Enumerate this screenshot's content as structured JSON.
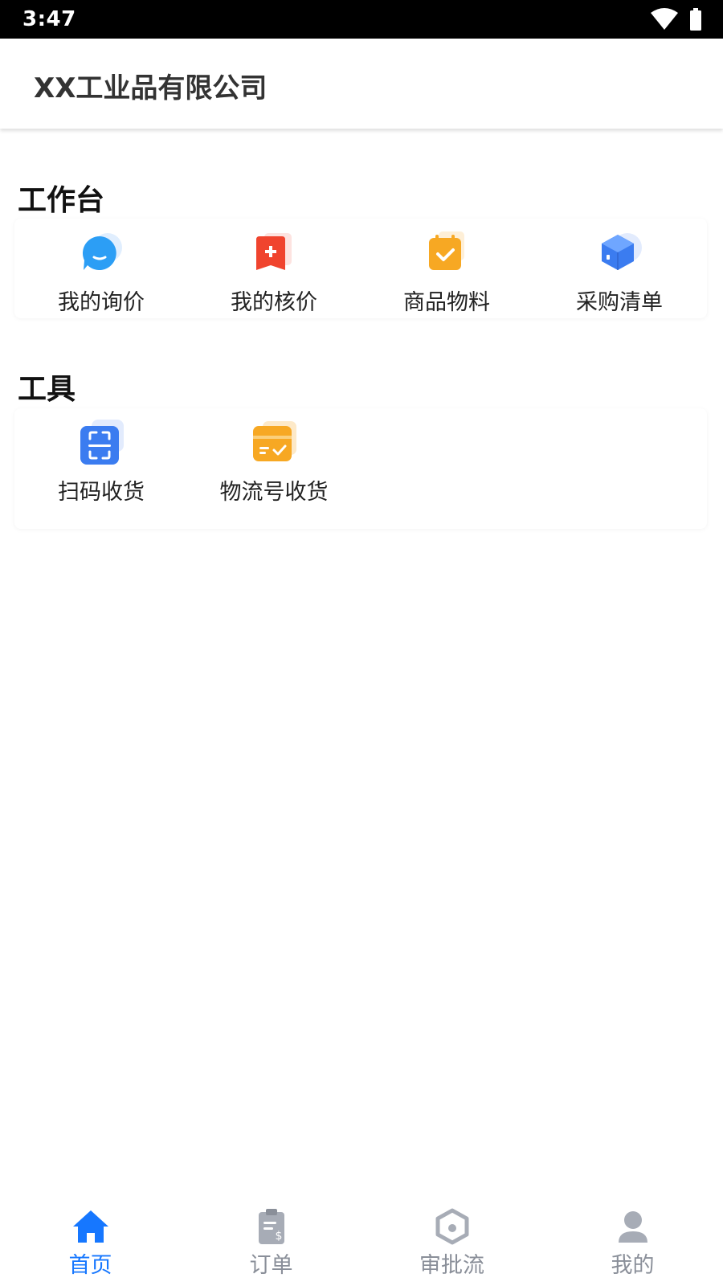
{
  "status_bar": {
    "time": "3:47"
  },
  "header": {
    "title": "XX工业品有限公司"
  },
  "workbench": {
    "title": "工作台",
    "items": [
      {
        "label": "我的询价",
        "icon": "chat-bubble-icon"
      },
      {
        "label": "我的核价",
        "icon": "medical-tag-icon"
      },
      {
        "label": "商品物料",
        "icon": "calendar-check-icon"
      },
      {
        "label": "采购清单",
        "icon": "cube-icon"
      }
    ]
  },
  "tools": {
    "title": "工具",
    "items": [
      {
        "label": "扫码收货",
        "icon": "scan-icon"
      },
      {
        "label": "物流号收货",
        "icon": "wallet-check-icon"
      }
    ]
  },
  "tabs": [
    {
      "label": "首页",
      "icon": "home-icon",
      "active": true
    },
    {
      "label": "订单",
      "icon": "clipboard-icon",
      "active": false
    },
    {
      "label": "审批流",
      "icon": "workflow-icon",
      "active": false
    },
    {
      "label": "我的",
      "icon": "user-icon",
      "active": false
    }
  ],
  "colors": {
    "accent": "#1677ff",
    "tab_inactive": "#8a8f99",
    "icon_blue": "#2c8ff5",
    "icon_red": "#f0442e",
    "icon_orange": "#f7a823"
  }
}
